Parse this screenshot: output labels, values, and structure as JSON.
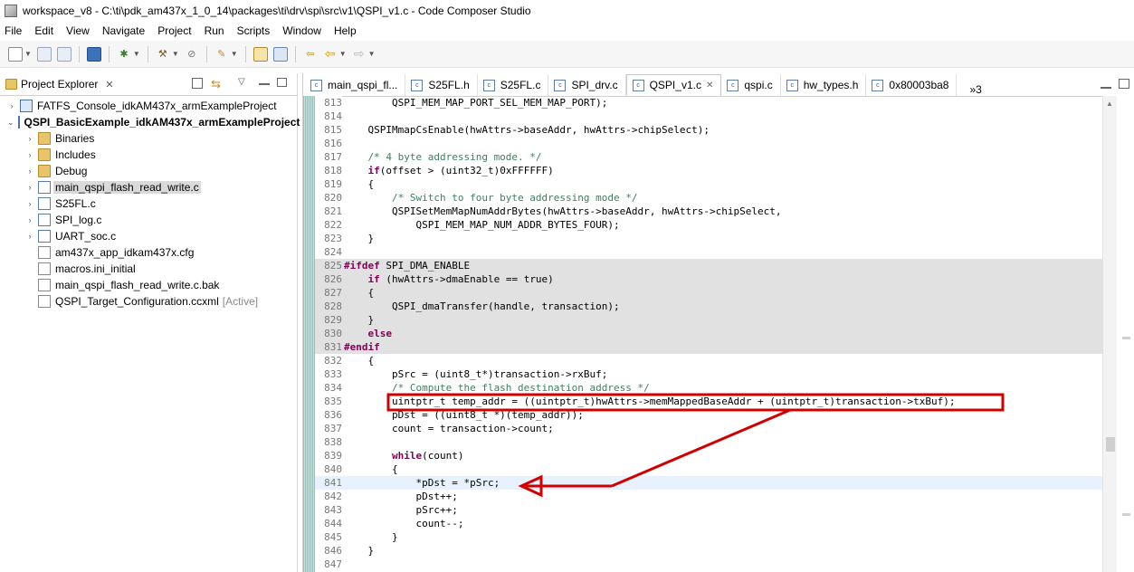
{
  "window": {
    "title": "workspace_v8 - C:\\ti\\pdk_am437x_1_0_14\\packages\\ti\\drv\\spi\\src\\v1\\QSPI_v1.c - Code Composer Studio"
  },
  "menu": [
    "File",
    "Edit",
    "View",
    "Navigate",
    "Project",
    "Run",
    "Scripts",
    "Window",
    "Help"
  ],
  "explorer": {
    "title": "Project Explorer",
    "close": "✕",
    "projects": [
      {
        "label": "FATFS_Console_idkAM437x_armExampleProject",
        "expanded": false
      },
      {
        "label": "QSPI_BasicExample_idkAM437x_armExampleProject",
        "expanded": true
      }
    ],
    "children": [
      {
        "label": "Binaries",
        "kind": "folder",
        "twist": "›"
      },
      {
        "label": "Includes",
        "kind": "folder",
        "twist": "›"
      },
      {
        "label": "Debug",
        "kind": "folder",
        "twist": "›"
      },
      {
        "label": "main_qspi_flash_read_write.c",
        "kind": "cfile",
        "twist": "›",
        "selected": true
      },
      {
        "label": "S25FL.c",
        "kind": "cfile",
        "twist": "›"
      },
      {
        "label": "SPI_log.c",
        "kind": "cfile",
        "twist": "›"
      },
      {
        "label": "UART_soc.c",
        "kind": "cfile",
        "twist": "›"
      },
      {
        "label": "am437x_app_idkam437x.cfg",
        "kind": "gen",
        "twist": ""
      },
      {
        "label": "macros.ini_initial",
        "kind": "gen",
        "twist": ""
      },
      {
        "label": "main_qspi_flash_read_write.c.bak",
        "kind": "gen",
        "twist": ""
      },
      {
        "label": "QSPI_Target_Configuration.ccxml",
        "kind": "gen",
        "twist": "",
        "tag": "[Active]"
      }
    ]
  },
  "editor": {
    "tabs": [
      {
        "label": "main_qspi_fl...",
        "active": false
      },
      {
        "label": "S25FL.h",
        "active": false
      },
      {
        "label": "S25FL.c",
        "active": false
      },
      {
        "label": "SPI_drv.c",
        "active": false
      },
      {
        "label": "QSPI_v1.c",
        "active": true
      },
      {
        "label": "qspi.c",
        "active": false
      },
      {
        "label": "hw_types.h",
        "active": false
      },
      {
        "label": "0x80003ba8",
        "active": false
      }
    ],
    "overflow": "»3",
    "lines": [
      {
        "n": "813",
        "t": "        QSPI_MEM_MAP_PORT_SEL_MEM_MAP_PORT);"
      },
      {
        "n": "814",
        "t": ""
      },
      {
        "n": "815",
        "t": "    QSPIMmapCsEnable(hwAttrs->baseAddr, hwAttrs->chipSelect);"
      },
      {
        "n": "816",
        "t": ""
      },
      {
        "n": "817",
        "t": "    /* 4 byte addressing mode. */",
        "cls": "cm"
      },
      {
        "n": "818",
        "t": "    if(offset > (uint32_t)0xFFFFFF)"
      },
      {
        "n": "819",
        "t": "    {"
      },
      {
        "n": "820",
        "t": "        /* Switch to four byte addressing mode */",
        "cls": "cm"
      },
      {
        "n": "821",
        "t": "        QSPISetMemMapNumAddrBytes(hwAttrs->baseAddr, hwAttrs->chipSelect,"
      },
      {
        "n": "822",
        "t": "            QSPI_MEM_MAP_NUM_ADDR_BYTES_FOUR);"
      },
      {
        "n": "823",
        "t": "    }"
      },
      {
        "n": "824",
        "t": ""
      },
      {
        "n": "825",
        "t": "#ifdef SPI_DMA_ENABLE",
        "bg": "ifdef"
      },
      {
        "n": "826",
        "t": "    if (hwAttrs->dmaEnable == true)",
        "bg": "ifdef"
      },
      {
        "n": "827",
        "t": "    {",
        "bg": "ifdef"
      },
      {
        "n": "828",
        "t": "        QSPI_dmaTransfer(handle, transaction);",
        "bg": "ifdef"
      },
      {
        "n": "829",
        "t": "    }",
        "bg": "ifdef"
      },
      {
        "n": "830",
        "t": "    else",
        "bg": "ifdef"
      },
      {
        "n": "831",
        "t": "#endif",
        "bg": "ifdef"
      },
      {
        "n": "832",
        "t": "    {"
      },
      {
        "n": "833",
        "t": "        pSrc = (uint8_t*)transaction->rxBuf;"
      },
      {
        "n": "834",
        "t": "        /* Compute the flash destination address */",
        "cls": "cm"
      },
      {
        "n": "835",
        "t": "        uintptr_t temp_addr = ((uintptr_t)hwAttrs->memMappedBaseAddr + (uintptr_t)transaction->txBuf);"
      },
      {
        "n": "836",
        "t": "        pDst = ((uint8_t *)(temp_addr));"
      },
      {
        "n": "837",
        "t": "        count = transaction->count;"
      },
      {
        "n": "838",
        "t": ""
      },
      {
        "n": "839",
        "t": "        while(count)"
      },
      {
        "n": "840",
        "t": "        {"
      },
      {
        "n": "841",
        "t": "            *pDst = *pSrc;",
        "bg": "curline"
      },
      {
        "n": "842",
        "t": "            pDst++;"
      },
      {
        "n": "843",
        "t": "            pSrc++;"
      },
      {
        "n": "844",
        "t": "            count--;"
      },
      {
        "n": "845",
        "t": "        }"
      },
      {
        "n": "846",
        "t": "    }"
      },
      {
        "n": "847",
        "t": ""
      }
    ]
  },
  "annotation": {
    "color": "#d00000",
    "highlighted_line": "835",
    "arrow_target_line": "841"
  }
}
